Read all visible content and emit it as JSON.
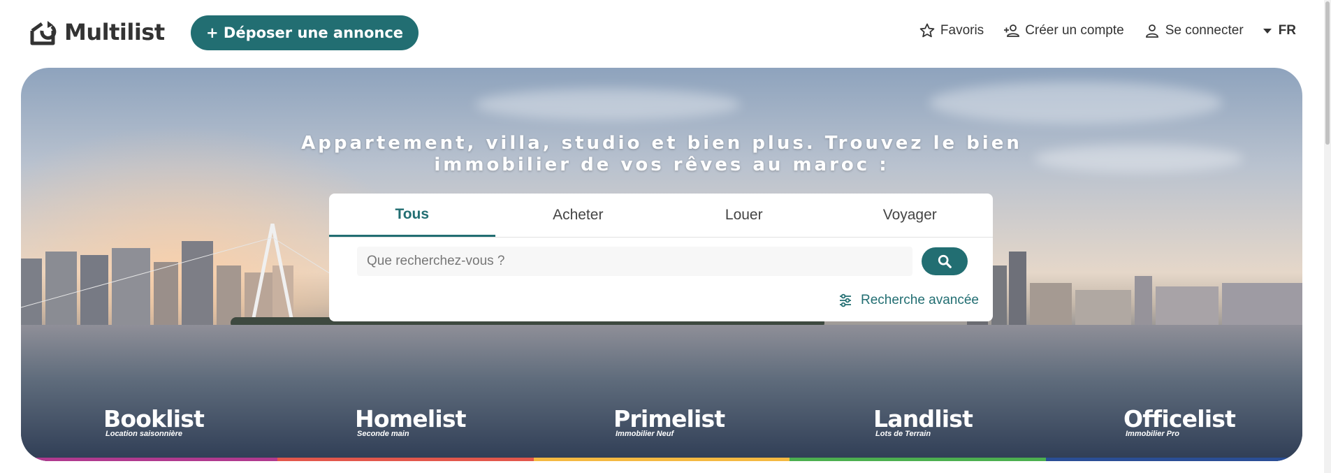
{
  "header": {
    "logo_text": "Multilist",
    "deposit_label": "+ Déposer une annonce",
    "nav": {
      "favoris": "Favoris",
      "create_account": "Créer un compte",
      "login": "Se connecter",
      "language": "FR"
    }
  },
  "hero": {
    "headline_line1": "Appartement, villa, studio et bien plus. Trouvez le bien",
    "headline_line2": "immobilier de vos rêves au maroc :",
    "tabs": [
      {
        "label": "Tous",
        "active": true
      },
      {
        "label": "Acheter",
        "active": false
      },
      {
        "label": "Louer",
        "active": false
      },
      {
        "label": "Voyager",
        "active": false
      }
    ],
    "search_placeholder": "Que recherchez-vous ?",
    "advanced_label": "Recherche avancée"
  },
  "brands": [
    {
      "name": "Booklist",
      "subtitle": "Location saisonnière",
      "color": "#b03a8f"
    },
    {
      "name": "Homelist",
      "subtitle": "Seconde main",
      "color": "#e2574c"
    },
    {
      "name": "Primelist",
      "subtitle": "Immobilier Neuf",
      "color": "#f4b942"
    },
    {
      "name": "Landlist",
      "subtitle": "Lots de Terrain",
      "color": "#4caf50"
    },
    {
      "name": "Officelist",
      "subtitle": "Immobilier Pro",
      "color": "#2a4e96"
    }
  ],
  "colors": {
    "accent": "#226e72"
  }
}
